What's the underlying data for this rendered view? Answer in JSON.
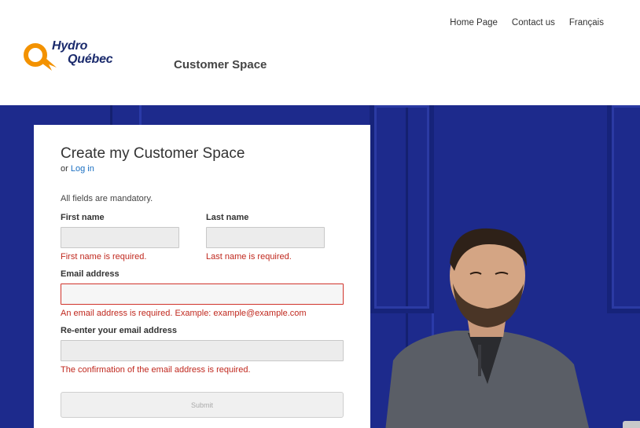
{
  "nav": {
    "home": "Home Page",
    "contact": "Contact us",
    "language": "Français"
  },
  "logo": {
    "line1": "Hydro",
    "line2": "Québec",
    "color": "#1a2a6c",
    "accent": "#f39200"
  },
  "header": {
    "title": "Customer Space"
  },
  "form": {
    "title": "Create my Customer Space",
    "or_text": "or",
    "login_link": "Log in",
    "mandatory_note": "All fields are mandatory.",
    "first_name": {
      "label": "First name",
      "value": "",
      "error": "First name is required."
    },
    "last_name": {
      "label": "Last name",
      "value": "",
      "error": "Last name is required."
    },
    "email": {
      "label": "Email address",
      "value": "",
      "error": "An email address is required. Example: example@example.com"
    },
    "email_confirm": {
      "label": "Re-enter your email address",
      "value": "",
      "error": "The confirmation of the email address is required."
    },
    "submit_label": "Submit"
  },
  "colors": {
    "hero_blue": "#1d2a8c",
    "error_red": "#c0281e",
    "link_blue": "#1a6fc2"
  }
}
